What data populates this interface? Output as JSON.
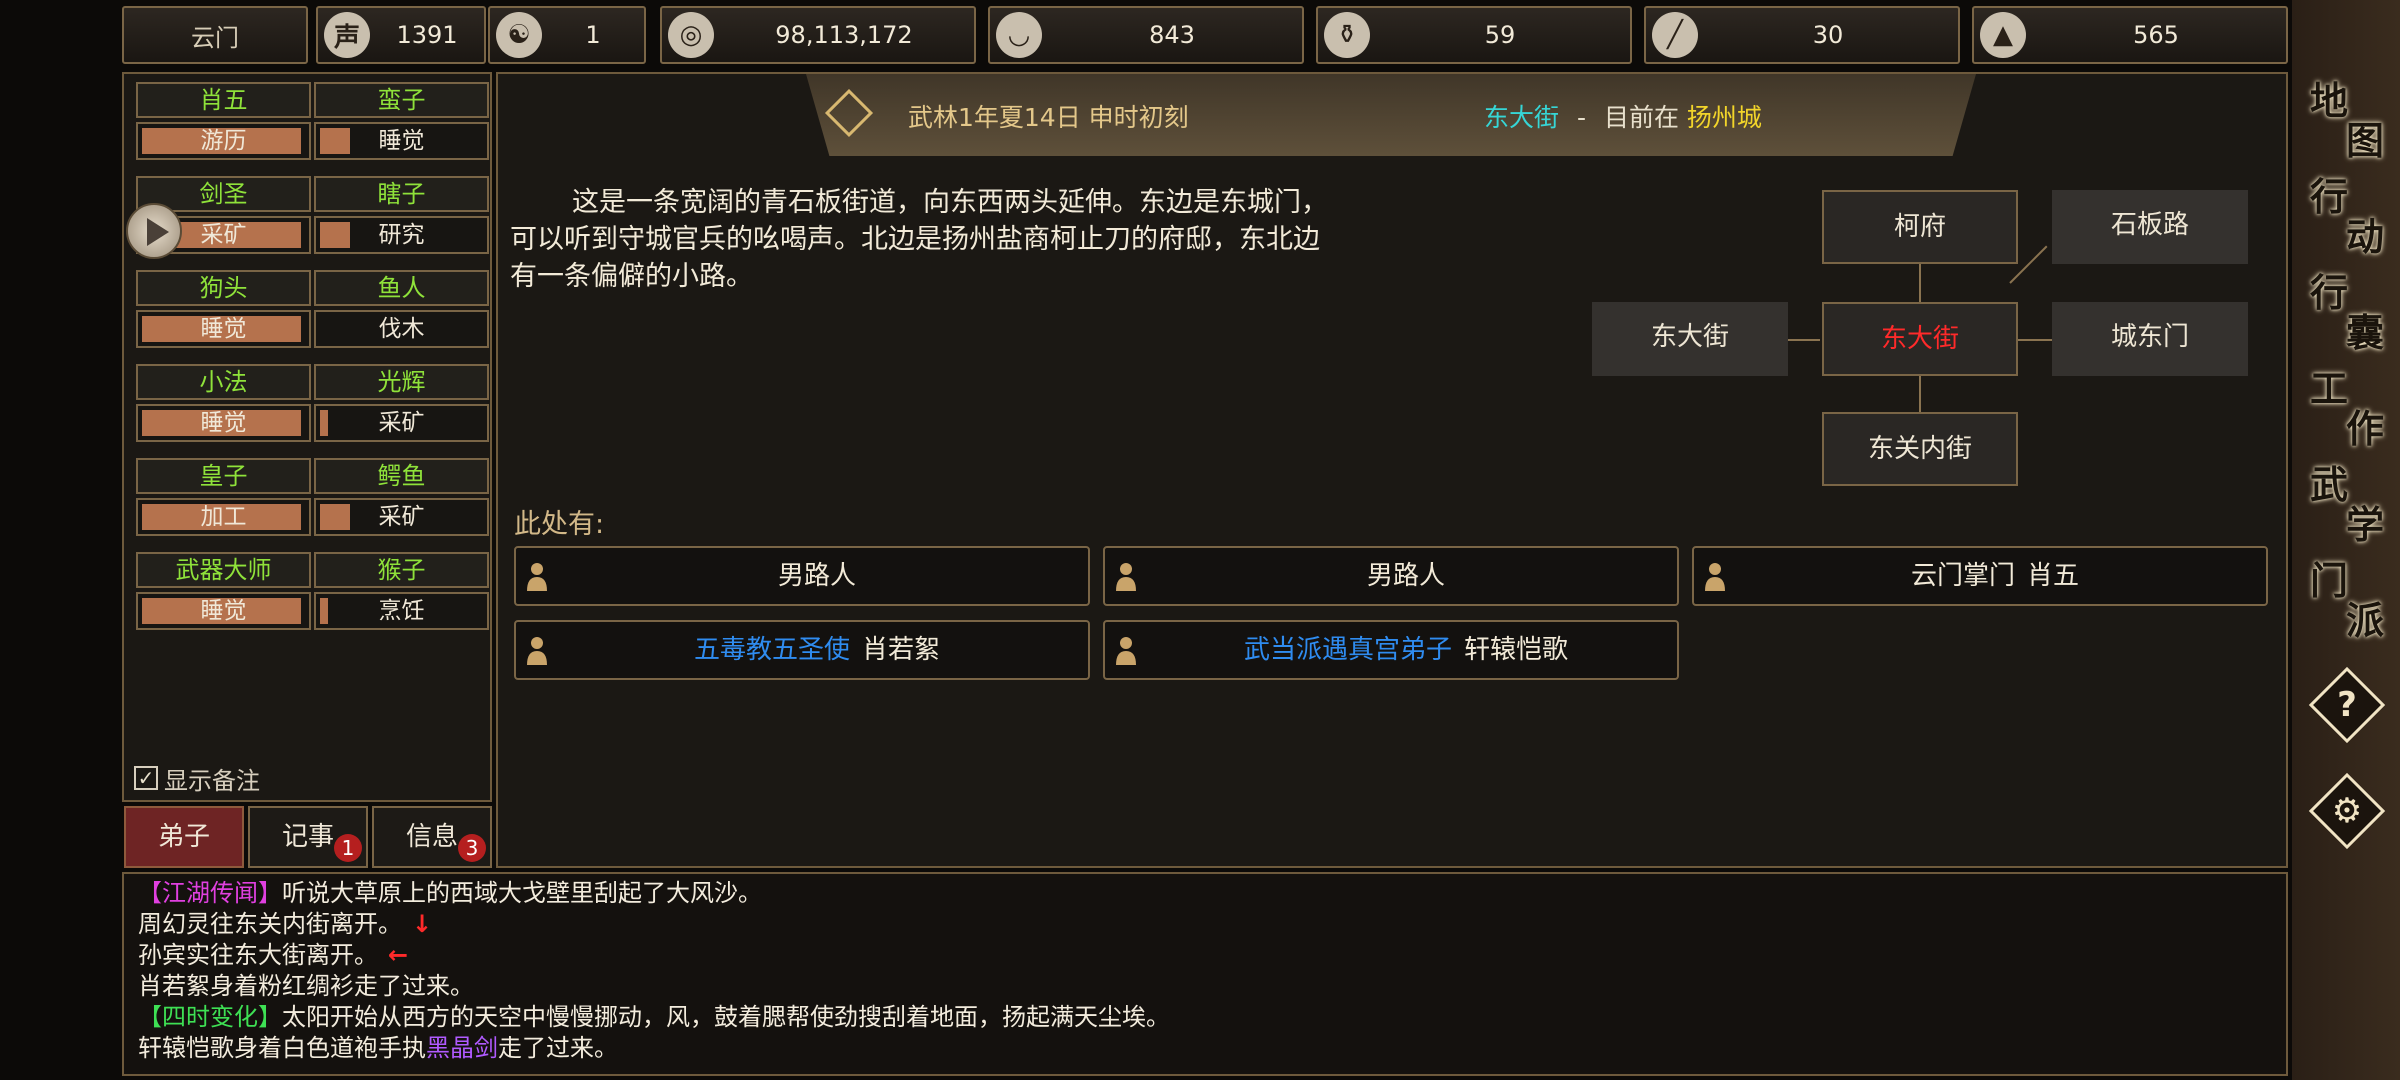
{
  "sect_name": "云门",
  "stats": [
    {
      "icon": "reputation-icon",
      "glyph": "声",
      "value": "1391"
    },
    {
      "icon": "yin-yang-icon",
      "glyph": "☯",
      "value": "1"
    },
    {
      "icon": "coin-icon",
      "glyph": "◎",
      "value": "98,113,172"
    },
    {
      "icon": "rice-bowl-icon",
      "glyph": "◡",
      "value": "843"
    },
    {
      "icon": "gourd-icon",
      "glyph": "⚱",
      "value": "59"
    },
    {
      "icon": "wood-icon",
      "glyph": "╱",
      "value": "30"
    },
    {
      "icon": "ore-icon",
      "glyph": "▲",
      "value": "565"
    }
  ],
  "disciples": [
    {
      "name": "肖五",
      "job": "游历",
      "progress": 0.95
    },
    {
      "name": "蛮子",
      "job": "睡觉",
      "progress": 0.18
    },
    {
      "name": "剑圣",
      "job": "采矿",
      "progress": 0.95
    },
    {
      "name": "瞎子",
      "job": "研究",
      "progress": 0.18
    },
    {
      "name": "狗头",
      "job": "睡觉",
      "progress": 0.95
    },
    {
      "name": "鱼人",
      "job": "伐木",
      "progress": 0.0
    },
    {
      "name": "小法",
      "job": "睡觉",
      "progress": 0.95
    },
    {
      "name": "光辉",
      "job": "采矿",
      "progress": 0.05
    },
    {
      "name": "皇子",
      "job": "加工",
      "progress": 0.95
    },
    {
      "name": "鳄鱼",
      "job": "采矿",
      "progress": 0.18
    },
    {
      "name": "武器大师",
      "job": "睡觉",
      "progress": 0.95
    },
    {
      "name": "猴子",
      "job": "烹饪",
      "progress": 0.05
    }
  ],
  "show_notes_label": "显示备注",
  "tabs": {
    "disciples": "弟子",
    "journal": "记事",
    "journal_badge": "1",
    "info": "信息",
    "info_badge": "3"
  },
  "header": {
    "date": "武林1年夏14日 申时初刻",
    "location": "东大街",
    "separator": "-",
    "in_city_prefix": "目前在",
    "city": "扬州城"
  },
  "description": [
    "这是一条宽阔的青石板街道，向东西两头延伸。东边是东城门，",
    "可以听到守城官兵的吆喝声。北边是扬州盐商柯止刀的府邸，东北边",
    "有一条偏僻的小路。"
  ],
  "map": {
    "north": "柯府",
    "northeast": "石板路",
    "west": "东大街",
    "center": "东大街",
    "east": "城东门",
    "south": "东关内街"
  },
  "here_label": "此处有:",
  "people": [
    {
      "title": "",
      "name": "男路人"
    },
    {
      "title": "",
      "name": "男路人"
    },
    {
      "title": "云门掌门",
      "name": "肖五"
    },
    {
      "title": "五毒教五圣使",
      "name": "肖若絮"
    },
    {
      "title": "武当派遇真宫弟子",
      "name": "轩辕恺歌"
    }
  ],
  "right_nav": [
    "地图",
    "行动",
    "行囊",
    "工作",
    "武学",
    "门派"
  ],
  "log": {
    "l1_tag": "【江湖传闻】",
    "l1_text": "听说大草原上的西域大戈壁里刮起了大风沙。",
    "l2_text": "周幻灵往东关内街离开。",
    "l2_arrow": "↓",
    "l3_text": "孙宾实往东大街离开。",
    "l3_arrow": "←",
    "l4_text": "肖若絮身着粉红绸衫走了过来。",
    "l5_tag": "【四时变化】",
    "l5_text": "太阳开始从西方的天空中慢慢挪动，风，鼓着腮帮使劲搜刮着地面，扬起满天尘埃。",
    "l6_pre": "轩辕恺歌身着白色道袍手执",
    "l6_item": "黑晶剑",
    "l6_post": "走了过来。"
  },
  "colors": {
    "progress": "#b5724d",
    "disciple_name": "#8fe23a",
    "location": "#36d6d6",
    "city": "#f2d52a",
    "map_current": "#ff2a2a",
    "title_blue": "#2f8cf0",
    "rumor": "#e040e0",
    "season": "#3ee054",
    "item": "#b05aff"
  }
}
